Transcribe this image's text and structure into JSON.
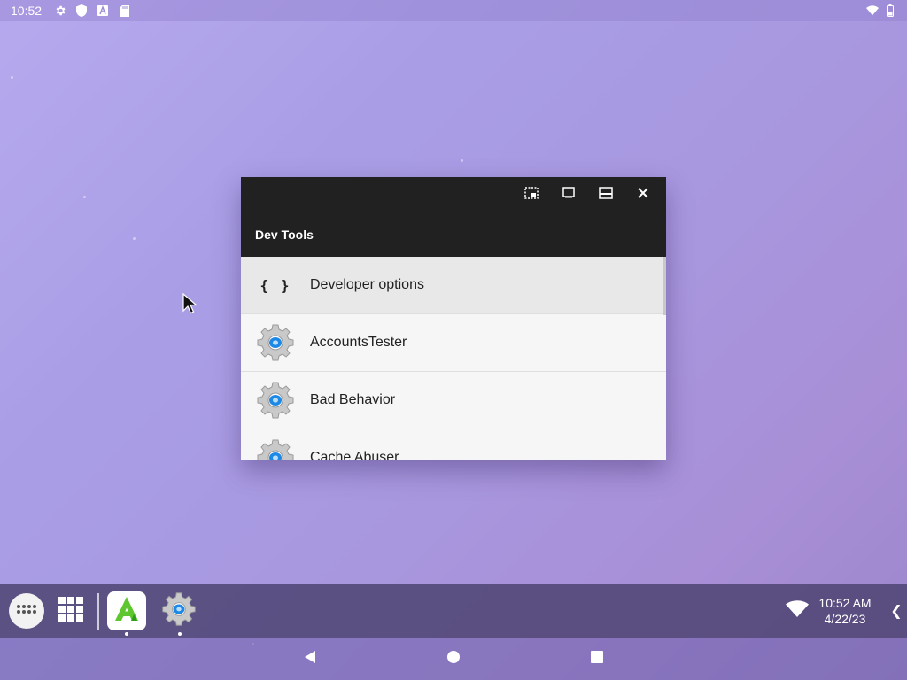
{
  "status_bar": {
    "time": "10:52",
    "icons": [
      "settings-icon",
      "shield-icon",
      "a-badge-icon",
      "sd-card-icon"
    ],
    "right_icons": [
      "wifi-icon",
      "battery-icon"
    ]
  },
  "window": {
    "title": "Dev Tools",
    "caption_buttons": [
      "pip-icon",
      "restore-icon",
      "maximize-icon",
      "close-icon"
    ],
    "items": [
      {
        "label": "Developer options",
        "icon": "braces-icon",
        "glyph": "{ }",
        "selected": true
      },
      {
        "label": "AccountsTester",
        "icon": "gear-app-icon"
      },
      {
        "label": "Bad Behavior",
        "icon": "gear-app-icon"
      },
      {
        "label": "Cache Abuser",
        "icon": "gear-app-icon"
      }
    ]
  },
  "taskbar": {
    "apps": [
      "app-drawer-icon",
      "recents-grid-icon",
      "aptoide-icon",
      "dev-tools-icon"
    ],
    "clock_time": "10:52 AM",
    "clock_date": "4/22/23",
    "expand_glyph": "❮"
  },
  "colors": {
    "window_bar": "#212121",
    "list_bg": "#f6f6f6",
    "selected_bg": "#e8e8e8",
    "taskbar": "#4b416e"
  }
}
